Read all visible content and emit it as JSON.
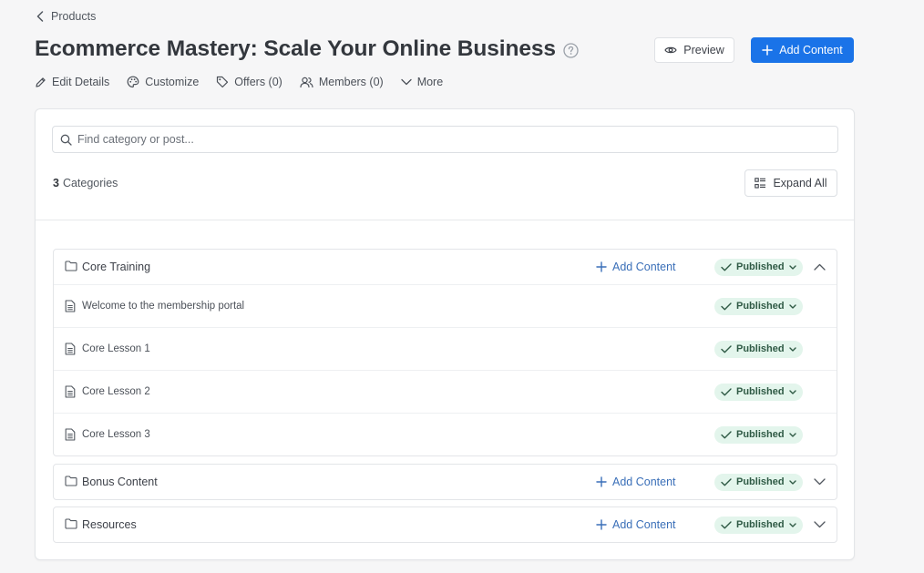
{
  "breadcrumb": {
    "label": "Products"
  },
  "header": {
    "title": "Ecommerce Mastery: Scale Your Online Business",
    "preview_label": "Preview",
    "add_content_label": "Add Content",
    "accent_color": "#1a73e8"
  },
  "tabs": [
    {
      "label": "Edit Details",
      "icon": "pencil-icon"
    },
    {
      "label": "Customize",
      "icon": "palette-icon"
    },
    {
      "label": "Offers (0)",
      "icon": "tag-icon"
    },
    {
      "label": "Members (0)",
      "icon": "users-icon"
    },
    {
      "label": "More",
      "icon": "chevron-down-icon"
    }
  ],
  "search": {
    "placeholder": "Find category or post...",
    "value": ""
  },
  "summary": {
    "count": "3",
    "count_label": "Categories",
    "expand_label": "Expand All"
  },
  "status_color": "#e3f5ec",
  "categories": [
    {
      "title": "Core Training",
      "add_label": "Add Content",
      "status": "Published",
      "expanded": true,
      "posts": [
        {
          "title": "Welcome to the membership portal",
          "status": "Published"
        },
        {
          "title": "Core Lesson 1",
          "status": "Published"
        },
        {
          "title": "Core Lesson 2",
          "status": "Published"
        },
        {
          "title": "Core Lesson 3",
          "status": "Published"
        }
      ]
    },
    {
      "title": "Bonus Content",
      "add_label": "Add Content",
      "status": "Published",
      "expanded": false,
      "posts": []
    },
    {
      "title": "Resources",
      "add_label": "Add Content",
      "status": "Published",
      "expanded": false,
      "posts": []
    }
  ]
}
